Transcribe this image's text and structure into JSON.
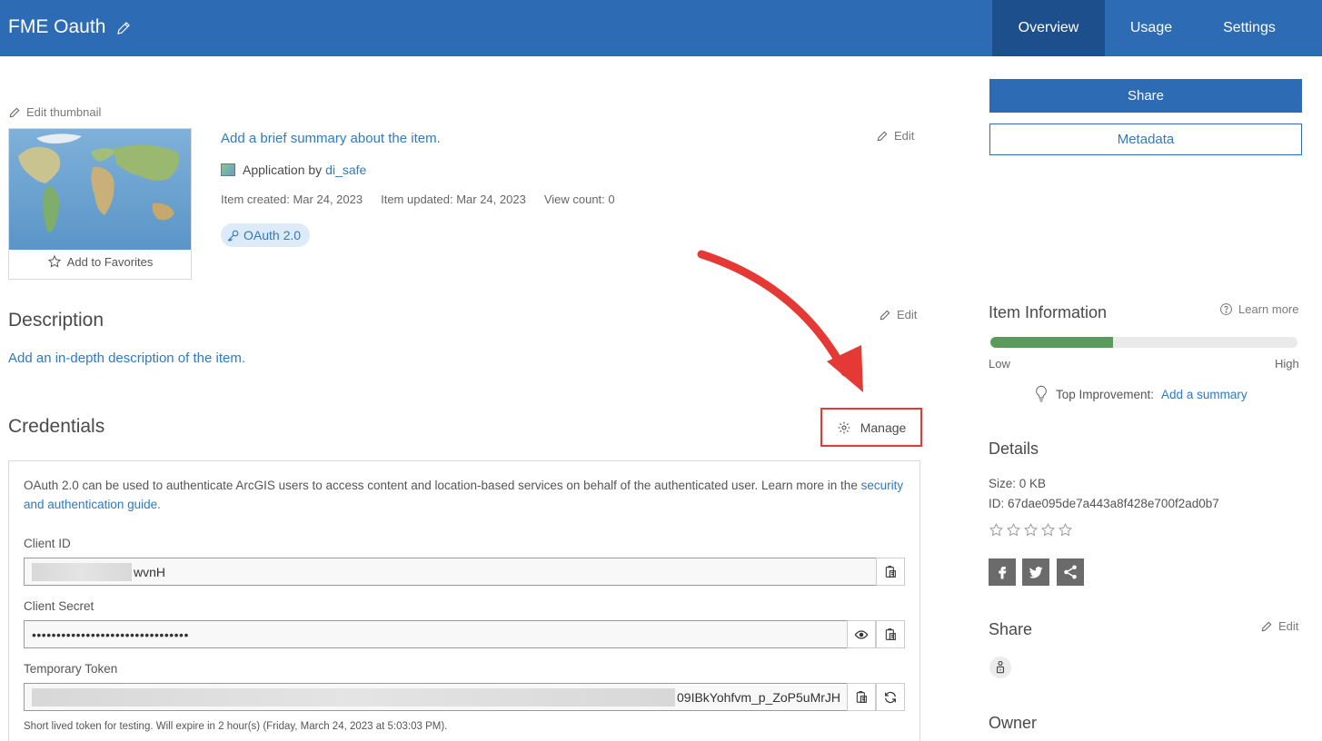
{
  "header": {
    "title": "FME Oauth",
    "tabs": [
      {
        "label": "Overview",
        "active": true
      },
      {
        "label": "Usage",
        "active": false
      },
      {
        "label": "Settings",
        "active": false
      }
    ]
  },
  "thumbnail": {
    "edit_label": "Edit thumbnail",
    "favorites_label": "Add to Favorites"
  },
  "summary": {
    "link": "Add a brief summary about the item.",
    "edit_label": "Edit",
    "type_prefix": "Application by",
    "owner": "di_safe",
    "created": "Item created: Mar 24, 2023",
    "updated": "Item updated: Mar 24, 2023",
    "views": "View count: 0",
    "tag": "OAuth 2.0"
  },
  "description": {
    "title": "Description",
    "edit_label": "Edit",
    "link": "Add an in-depth description of the item."
  },
  "credentials": {
    "title": "Credentials",
    "manage_label": "Manage",
    "intro_text": "OAuth 2.0 can be used to authenticate ArcGIS users to access content and location-based services on behalf of the authenticated user. Learn more in the",
    "intro_link": "security and authentication guide.",
    "client_id_label": "Client ID",
    "client_id_value": "wvnH",
    "client_secret_label": "Client Secret",
    "client_secret_value": "••••••••••••••••••••••••••••••••",
    "token_label": "Temporary Token",
    "token_value": "09IBkYohfvm_p_ZoP5uMrJH",
    "token_help": "Short lived token for testing. Will expire in 2 hour(s) (Friday, March 24, 2023 at 5:03:03 PM)."
  },
  "sidebar": {
    "share_button": "Share",
    "metadata_button": "Metadata",
    "item_info_title": "Item Information",
    "learn_more": "Learn more",
    "info_level": 0.4,
    "low_label": "Low",
    "high_label": "High",
    "top_improvement_label": "Top Improvement:",
    "top_improvement_link": "Add a summary",
    "details_title": "Details",
    "size": "Size: 0 KB",
    "id": "ID: 67dae095de7a443a8f428e700f2ad0b7",
    "rating": 0,
    "share_title": "Share",
    "share_edit": "Edit",
    "owner_title": "Owner"
  },
  "colors": {
    "header": "#2d6bb5",
    "active_tab": "#1d4f8c",
    "link": "#2f7ac1",
    "annotation": "#e53935",
    "progress": "#5a9a5a"
  }
}
